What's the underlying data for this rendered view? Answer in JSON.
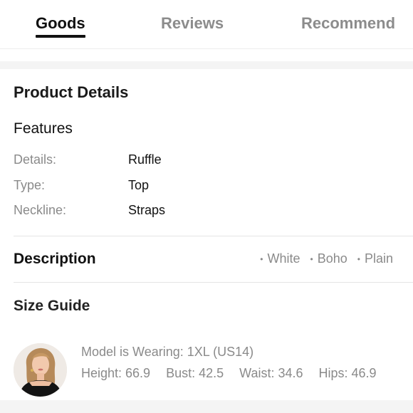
{
  "tabs": [
    {
      "label": "Goods",
      "active": true
    },
    {
      "label": "Reviews",
      "active": false
    },
    {
      "label": "Recommend",
      "active": false
    }
  ],
  "product_details": {
    "title": "Product Details",
    "features_title": "Features",
    "features": [
      {
        "key": "Details:",
        "value": "Ruffle"
      },
      {
        "key": "Type:",
        "value": "Top"
      },
      {
        "key": "Neckline:",
        "value": "Straps"
      }
    ]
  },
  "description": {
    "title": "Description",
    "tags": [
      "White",
      "Boho",
      "Plain"
    ]
  },
  "size_guide": {
    "title": "Size Guide",
    "model_wearing": "Model is Wearing: 1XL (US14)",
    "measurements": [
      "Height: 66.9",
      "Bust: 42.5",
      "Waist: 34.6",
      "Hips: 46.9"
    ]
  },
  "colors": {
    "text_primary": "#111111",
    "text_secondary": "#8a8a8a",
    "tab_inactive": "#8c8c8c",
    "separator_band": "#f4f4f4",
    "divider": "#e4e4e4"
  },
  "icons": {
    "avatar": "model-avatar-photo",
    "tag_bullet": "bullet-dot"
  }
}
